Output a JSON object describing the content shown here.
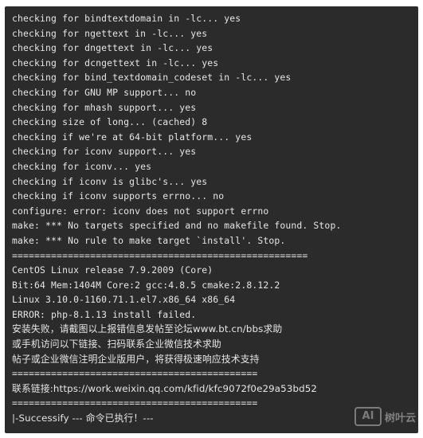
{
  "terminal": {
    "lines": [
      "checking for bindtextdomain in -lc... yes",
      "checking for ngettext in -lc... yes",
      "checking for dngettext in -lc... yes",
      "checking for dcngettext in -lc... yes",
      "checking for bind_textdomain_codeset in -lc... yes",
      "checking for GNU MP support... no",
      "checking for mhash support... yes",
      "checking size of long... (cached) 8",
      "checking if we're at 64-bit platform... yes",
      "checking for iconv support... yes",
      "checking for iconv... yes",
      "checking if iconv is glibc's... yes",
      "checking if iconv supports errno... no",
      "configure: error: iconv does not support errno",
      "make: *** No targets specified and no makefile found. Stop.",
      "make: *** No rule to make target `install'. Stop.",
      "=====================================================",
      "CentOS Linux release 7.9.2009 (Core)",
      "Bit:64 Mem:1404M Core:2 gcc:4.8.5 cmake:2.8.12.2",
      "Linux 3.10.0-1160.71.1.el7.x86_64 x86_64",
      "ERROR: php-8.1.13 install failed.",
      "安装失败，请截图以上报错信息发帖至论坛www.bt.cn/bbs求助",
      "或手机访问以下链接、扫码联系企业微信技术求助",
      "帖子或企业微信注明企业版用户，将获得极速响应技术支持",
      "============================================",
      "联系链接:https://work.weixin.qq.com/kfid/kfc9072f0e29a53bd52",
      "============================================",
      "|-Successify --- 命令已执行！---"
    ]
  },
  "watermark": {
    "logo": "AI",
    "text": "树叶云"
  },
  "colors": {
    "terminal_bg": "#2b2b2b",
    "terminal_fg": "#e6e6e6"
  }
}
